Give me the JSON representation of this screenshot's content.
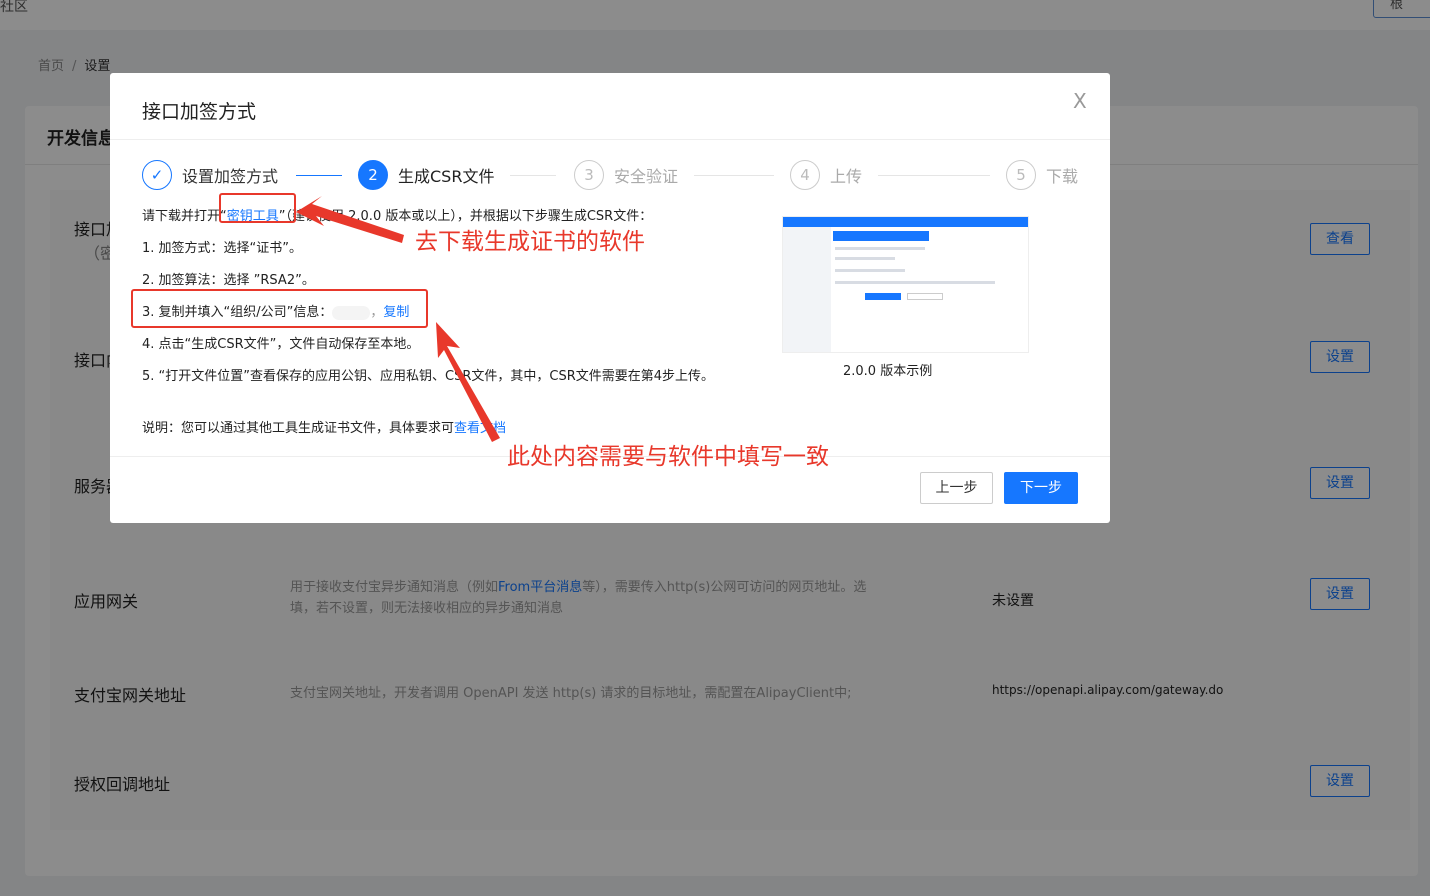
{
  "topbar": {
    "left_text": "社区",
    "right_button": "根"
  },
  "breadcrumb": {
    "home": "首页",
    "separator": "/",
    "current": "设置"
  },
  "card": {
    "title": "开发信息"
  },
  "rows": [
    {
      "label": "接口加",
      "label2": "（密钥",
      "button": "查看"
    },
    {
      "label": "接口内",
      "button": "设置"
    },
    {
      "label": "服务器",
      "button": "设置"
    },
    {
      "label": "应用网关",
      "desc_part1": "用于接收支付宝异步通知消息（例如",
      "desc_link": "From平台消息",
      "desc_part2": "等），需要传入http(s)公网可访问的网页地址。选",
      "desc_line2": "填，若不设置，则无法接收相应的异步通知消息",
      "value": "未设置",
      "button": "设置"
    },
    {
      "label": "支付宝网关地址",
      "desc": "支付宝网关地址，开发者调用 OpenAPI 发送 http(s) 请求的目标地址，需配置在AlipayClient中;",
      "value": "https://openapi.alipay.com/gateway.do"
    },
    {
      "label": "授权回调地址",
      "button": "设置"
    }
  ],
  "modal": {
    "title": "接口加签方式",
    "close": "X",
    "steps": [
      {
        "num": "✓",
        "label": "设置加签方式"
      },
      {
        "num": "2",
        "label": "生成CSR文件"
      },
      {
        "num": "3",
        "label": "安全验证"
      },
      {
        "num": "4",
        "label": "上传"
      },
      {
        "num": "5",
        "label": "下载"
      }
    ],
    "intro_prefix": "请下载并打开“",
    "intro_link": "密钥工具",
    "intro_suffix": "”（建议使用 2.0.0 版本或以上），并根据以下步骤生成CSR文件：",
    "item1": "1. 加签方式：选择“证书”。",
    "item2": "2. 加签算法：选择 ”RSA2”。",
    "item3_prefix": "3. 复制并填入“组织/公司”信息：",
    "item3_sep": "，",
    "item3_link": "复制",
    "item4": "4. 点击“生成CSR文件”，文件自动保存至本地。",
    "item5": "5. “打开文件位置”查看保存的应用公钥、应用私钥、CSR文件，其中，CSR文件需要在第4步上传。",
    "note_prefix": "说明：您可以通过其他工具生成证书文件，具体要求可",
    "note_link": "查看文档",
    "preview_caption": "2.0.0 版本示例",
    "prev_button": "上一步",
    "next_button": "下一步"
  },
  "annotations": {
    "download_hint": "去下载生成证书的软件",
    "consistency_hint": "此处内容需要与软件中填写一致"
  },
  "colors": {
    "primary": "#1677ff",
    "annotation_red": "#e8382b"
  }
}
